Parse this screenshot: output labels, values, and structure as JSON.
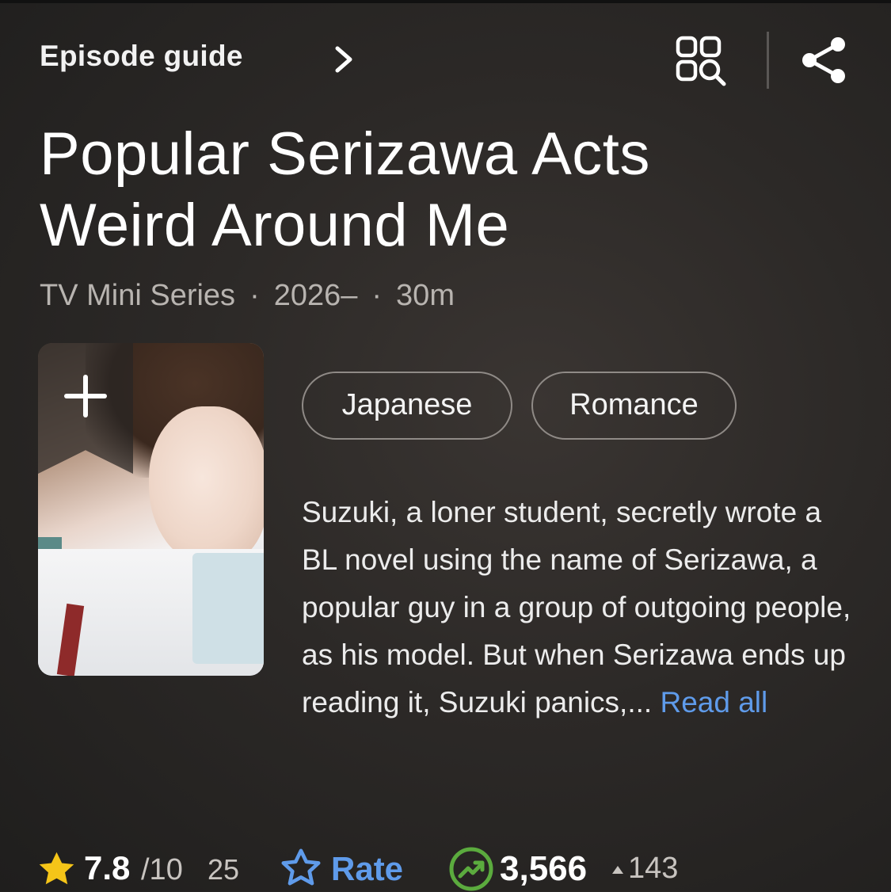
{
  "header": {
    "episode_guide_label": "Episode guide",
    "chevron_icon": "chevron-right-icon",
    "grid_search_icon": "grid-search-icon",
    "share_icon": "share-icon"
  },
  "title": {
    "line1": "Popular Serizawa Acts",
    "line2": "Weird Around Me"
  },
  "meta": {
    "type": "TV Mini Series",
    "years": "2026–",
    "runtime": "30m",
    "separator": "·"
  },
  "poster": {
    "watchlist_icon": "plus-icon"
  },
  "genres": [
    "Japanese",
    "Romance"
  ],
  "description": {
    "text": "Suzuki, a loner student, secretly wrote a BL novel using the name of Serizawa, a popular guy in a group of outgoing people, as his model. But when Serizawa ends up reading it, Suzuki panics,...",
    "read_all_label": "Read all"
  },
  "ratings": {
    "rating_value": "7.8",
    "rating_max": "/10",
    "rating_count": "25",
    "rate_label": "Rate",
    "popularity": "3,566",
    "popularity_delta": "143"
  },
  "colors": {
    "accent_blue": "#5f9bea",
    "star_yellow": "#f5c518",
    "trend_green": "#5bab3e"
  }
}
